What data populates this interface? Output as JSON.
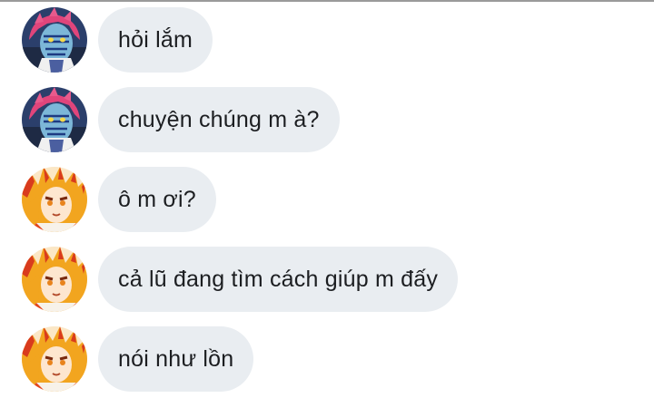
{
  "messages": [
    {
      "sender": "akaza-avatar",
      "text": "hỏi lắm"
    },
    {
      "sender": "akaza-avatar",
      "text": "chuyện chúng m à?"
    },
    {
      "sender": "rengoku-avatar",
      "text": "ô m ơi?"
    },
    {
      "sender": "rengoku-avatar",
      "text": "cả lũ đang tìm cách giúp m đấy"
    },
    {
      "sender": "rengoku-avatar",
      "text": "nói như lồn"
    }
  ],
  "colors": {
    "bubble_background": "#e9edf1",
    "text": "#1c1e21",
    "akaza_hair": "#e0457b",
    "akaza_skin": "#7cb7d8",
    "rengoku_hair": "#f2a51f",
    "rengoku_tips": "#d93b1d"
  }
}
